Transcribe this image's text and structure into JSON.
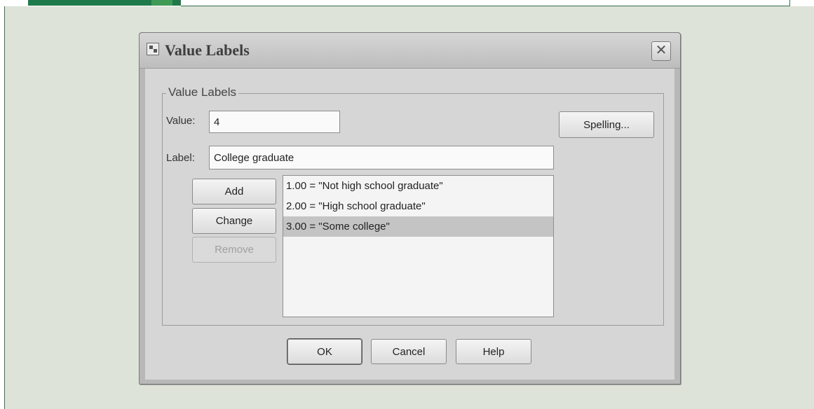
{
  "dialog": {
    "title": "Value Labels",
    "group_label": "Value Labels",
    "value_label": "Value:",
    "value": "4",
    "label_label": "Label:",
    "label_value": "College graduate",
    "buttons": {
      "spelling": "Spelling...",
      "add": "Add",
      "change": "Change",
      "remove": "Remove",
      "ok": "OK",
      "cancel": "Cancel",
      "help": "Help"
    },
    "list": [
      {
        "text": "1.00 = \"Not high school graduate\"",
        "selected": false
      },
      {
        "text": "2.00 = \"High school graduate\"",
        "selected": false
      },
      {
        "text": "3.00 = \"Some college\"",
        "selected": true
      }
    ]
  },
  "icons": {
    "title": "dialog-app-icon",
    "close": "close-icon"
  },
  "colors": {
    "panel_background": "#dde3d9",
    "frame_green": "#1f7a4b",
    "dialog_body": "#d6d6d6",
    "selection": "#c4c4c4"
  }
}
